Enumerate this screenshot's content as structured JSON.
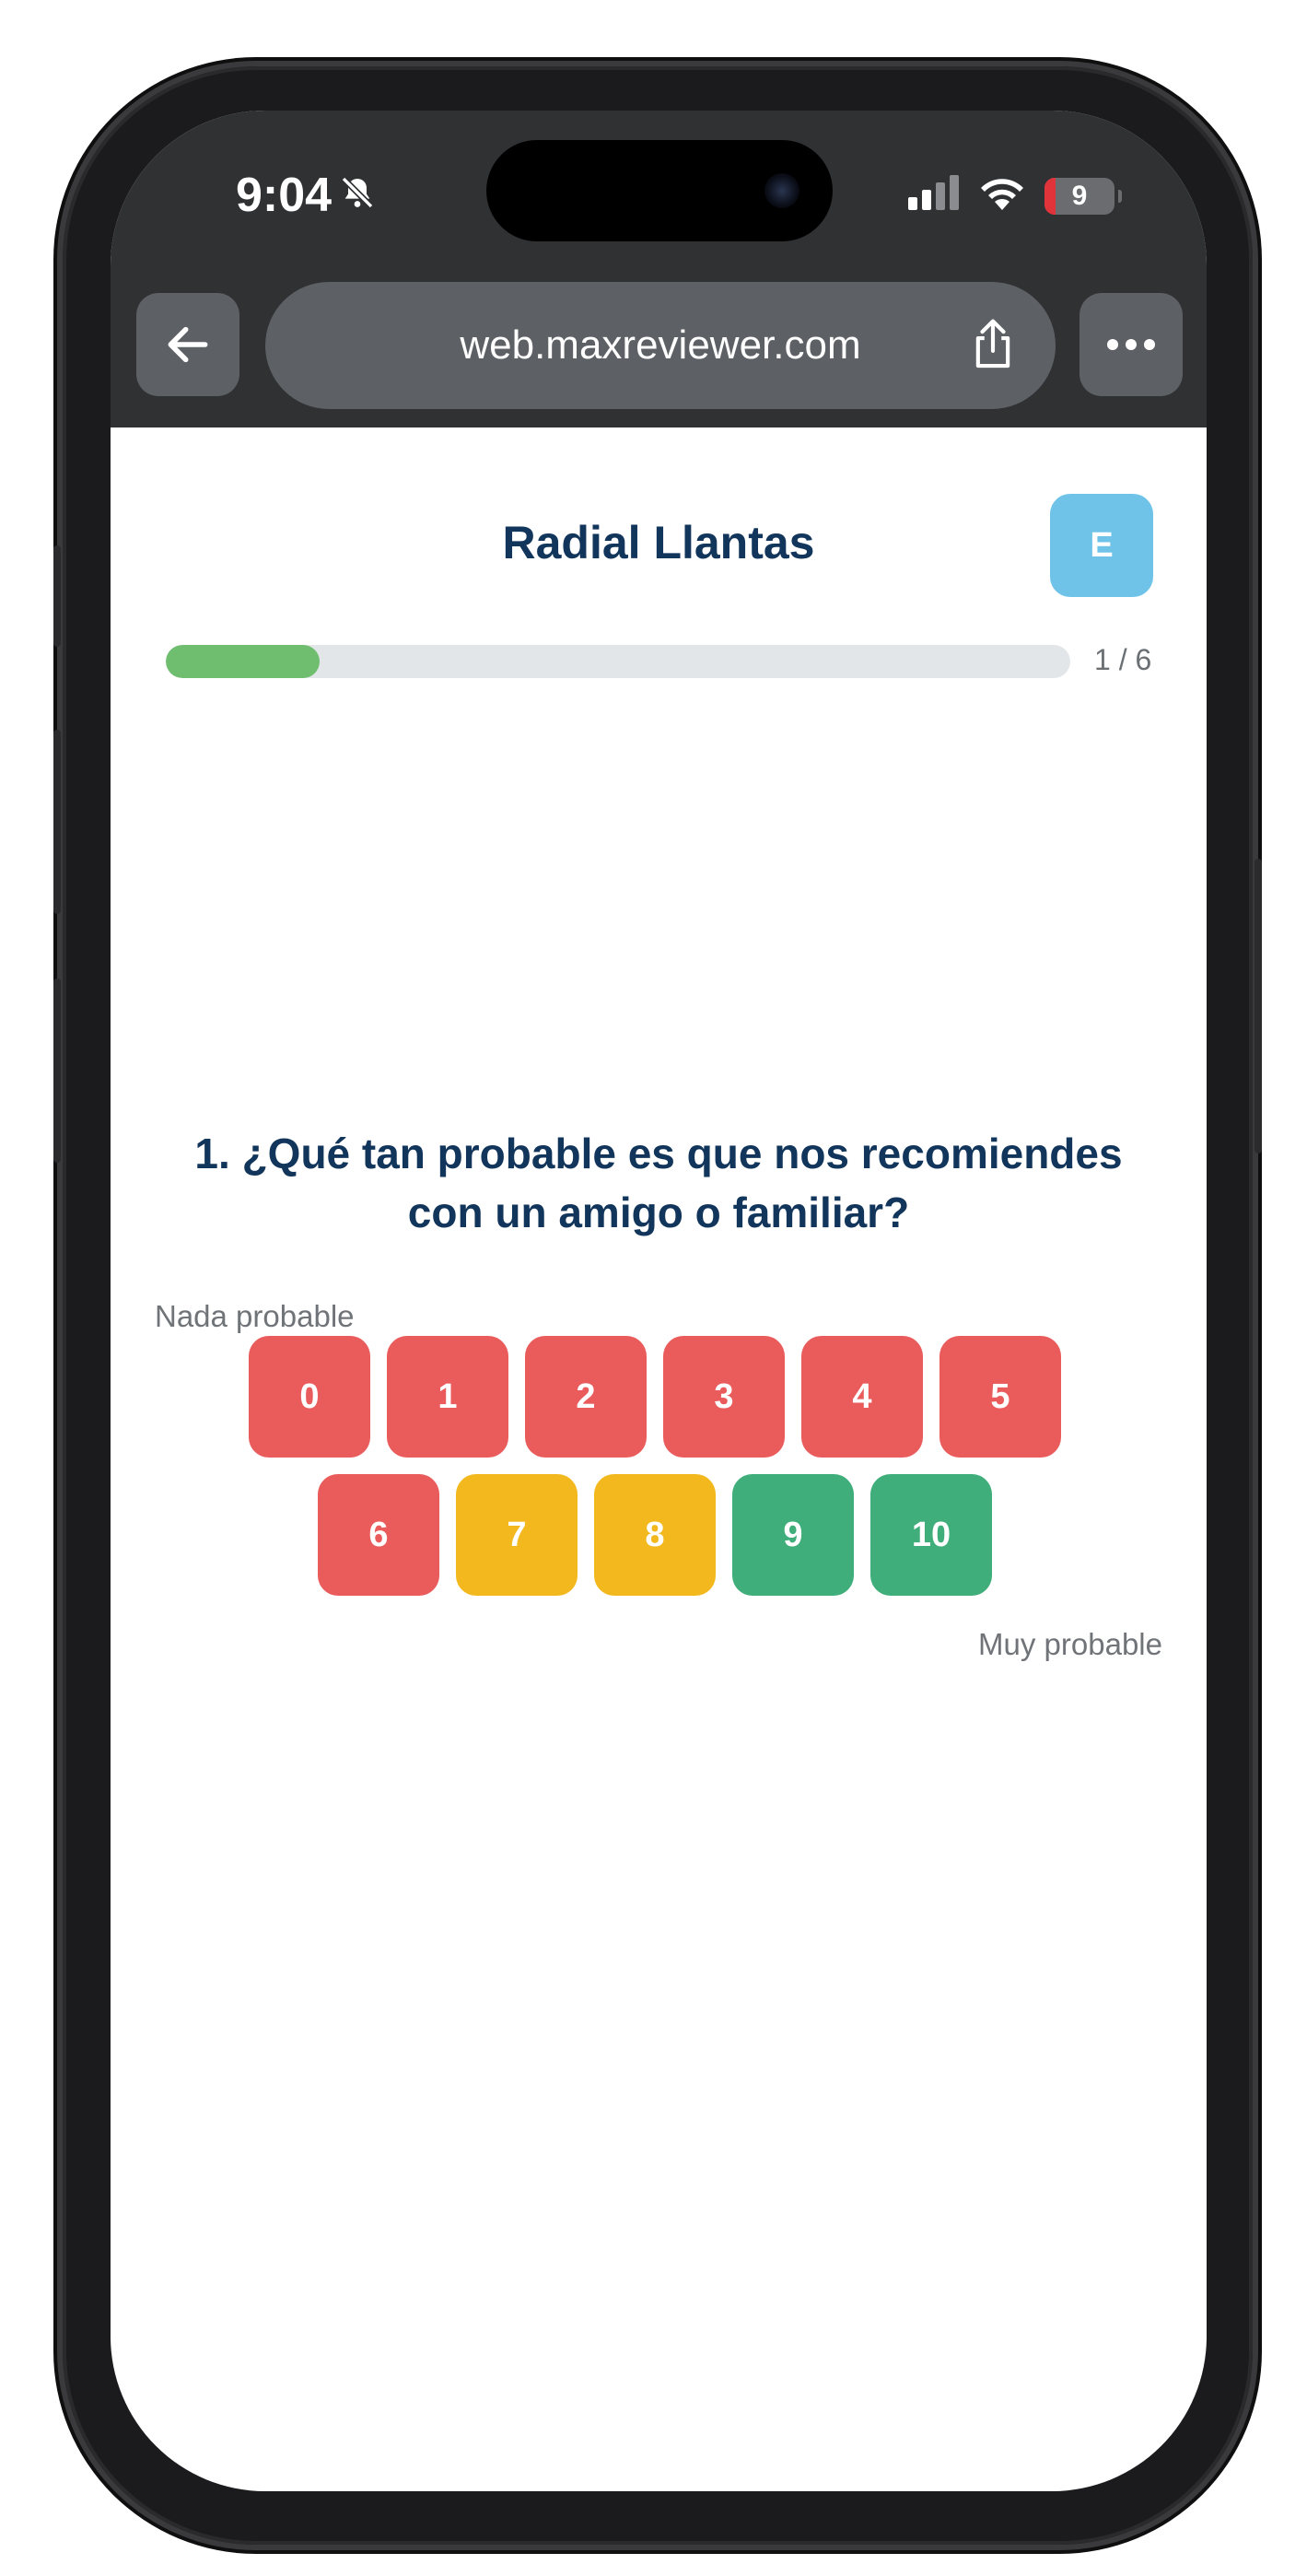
{
  "status_bar": {
    "time": "9:04",
    "battery_level": "9"
  },
  "browser": {
    "url": "web.maxreviewer.com"
  },
  "survey": {
    "title": "Radial Llantas",
    "language_button": "E",
    "progress_label": "1 / 6",
    "progress_fraction": 0.17,
    "question": "1. ¿Qué tan probable es que nos recomiendes con un amigo o familiar?",
    "left_label": "Nada probable",
    "right_label": "Muy probable",
    "scores": [
      "0",
      "1",
      "2",
      "3",
      "4",
      "5",
      "6",
      "7",
      "8",
      "9",
      "10"
    ],
    "score_colors": [
      "#ea5b5b",
      "#ea5b5b",
      "#ea5b5b",
      "#ea5b5b",
      "#ea5b5b",
      "#ea5b5b",
      "#ea5b5b",
      "#f2b81d",
      "#f2b81d",
      "#3fae7a",
      "#3fae7a"
    ]
  }
}
